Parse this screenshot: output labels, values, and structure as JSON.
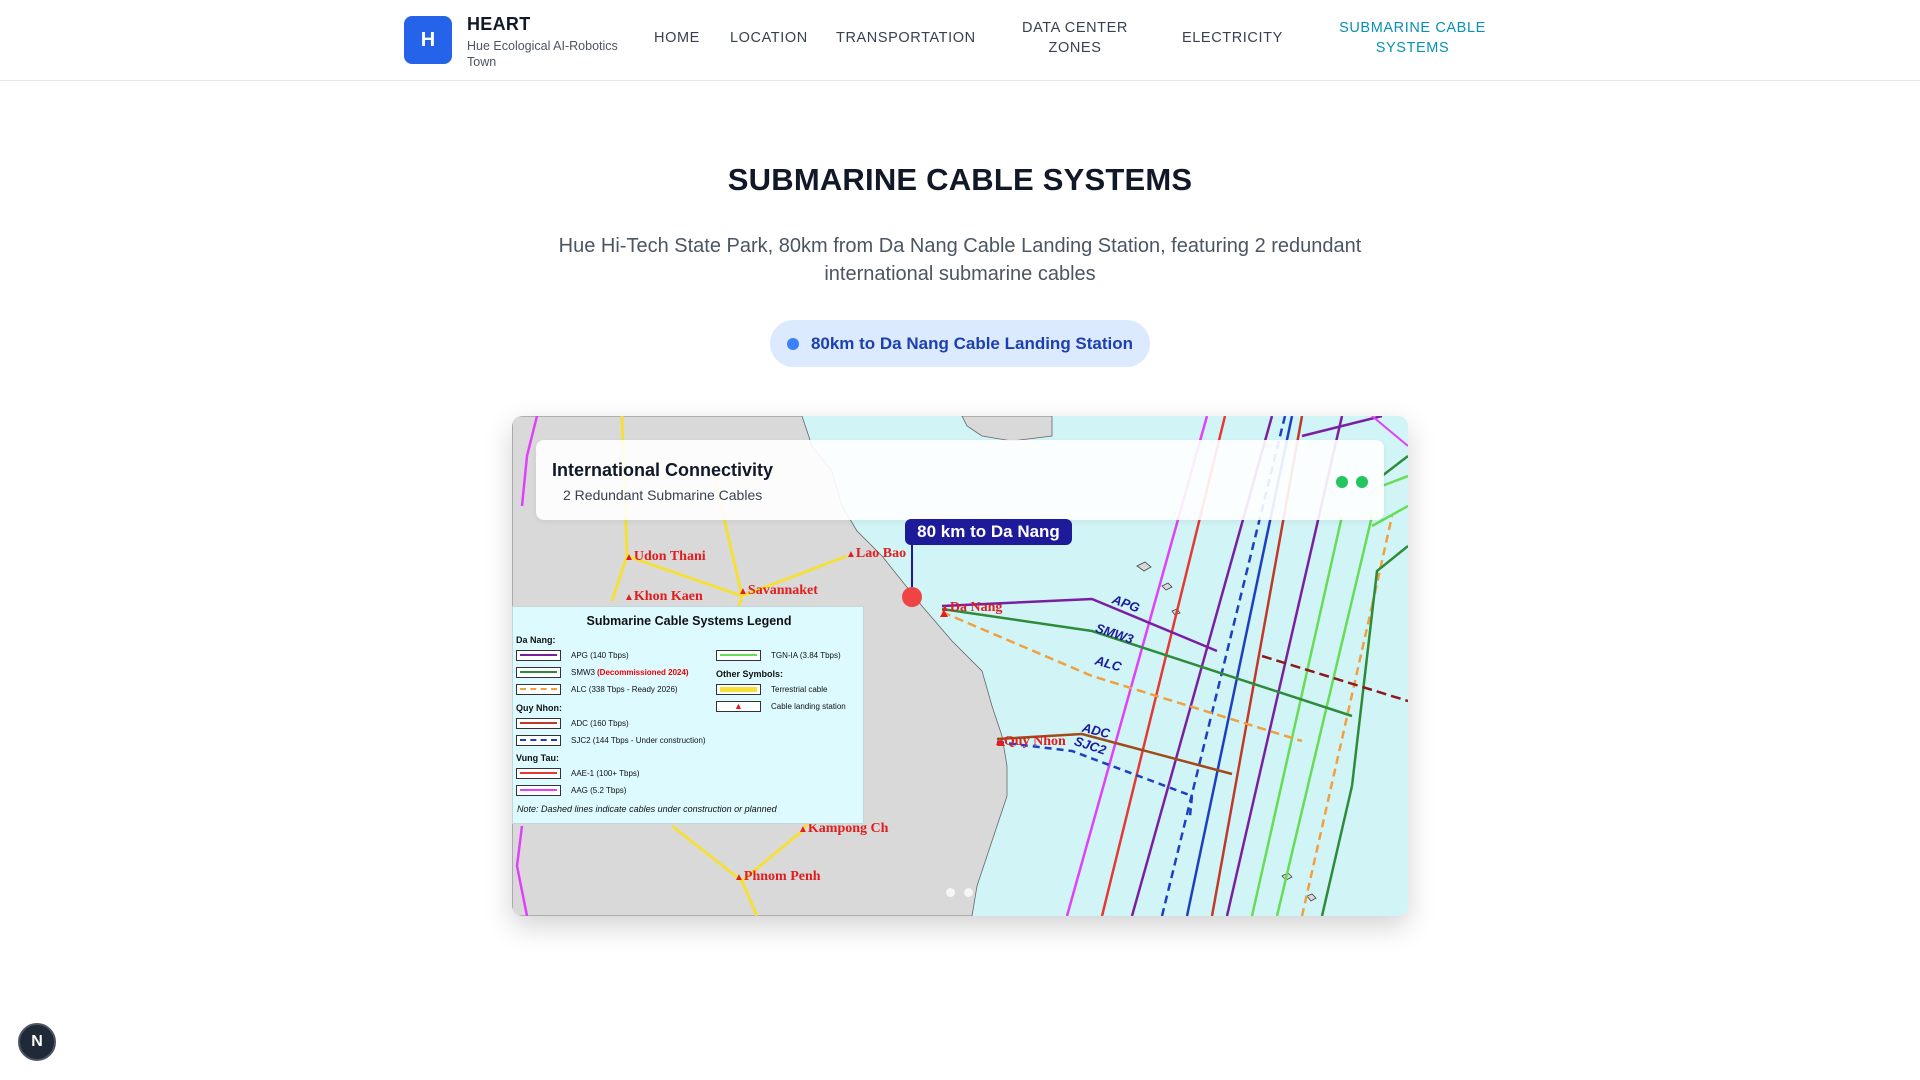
{
  "header": {
    "logo_letter": "H",
    "brand_title": "HEART",
    "brand_subtitle": "Hue Ecological AI-Robotics Town",
    "nav": [
      {
        "label": "HOME"
      },
      {
        "label": "LOCATION"
      },
      {
        "label": "TRANSPORTATION"
      },
      {
        "label": "DATA CENTER ZONES"
      },
      {
        "label": "ELECTRICITY"
      },
      {
        "label": "SUBMARINE CABLE SYSTEMS"
      }
    ],
    "active_nav": "SUBMARINE CABLE SYSTEMS"
  },
  "hero": {
    "title": "SUBMARINE CABLE SYSTEMS",
    "subtitle": "Hue Hi-Tech State Park, 80km from Da Nang Cable Landing Station, featuring 2 redundant international submarine cables",
    "pill_text": "80km to Da Nang Cable Landing Station"
  },
  "map": {
    "panel_title": "International Connectivity",
    "panel_subtitle": "2 Redundant Submarine Cables",
    "callout": "80 km to Da Nang",
    "cities": [
      "Udon Thani",
      "Lao Bao",
      "Khon Kaen",
      "Savannaket",
      "Da Nang",
      "Quy Nhon",
      "Kampong Ch",
      "Phnom Penh"
    ],
    "cable_labels": [
      "APG",
      "SMW3",
      "ALC",
      "ADC",
      "SJC2"
    ],
    "legend": {
      "title": "Submarine Cable Systems Legend",
      "groups": {
        "da_nang": "Da Nang:",
        "quy_nhon": "Quy Nhon:",
        "vung_tau": "Vung Tau:",
        "other": "Other Symbols:"
      },
      "items": {
        "apg": "APG (140 Tbps)",
        "smw3": "SMW3",
        "smw3_note": "(Decommissioned 2024)",
        "alc": "ALC (338 Tbps - Ready 2026)",
        "adc": "ADC (160 Tbps)",
        "sjc2": "SJC2 (144 Tbps - Under construction)",
        "aae1": "AAE-1 (100+ Tbps)",
        "aag": "AAG (5.2 Tbps)",
        "tgn": "TGN-IA (3.84 Tbps)",
        "terrestrial": "Terrestrial cable",
        "landing": "Cable landing station"
      },
      "note": "Note: Dashed lines indicate cables under construction or planned"
    },
    "colors": {
      "apg": "#7b1fa2",
      "smw3": "#2e8b3a",
      "alc": "#f0a040",
      "adc": "#c0392b",
      "sjc2": "#1f3fbf",
      "aae1": "#e53935",
      "aag": "#e040fb",
      "tgn": "#66dd55",
      "terrestrial": "#f5e03a",
      "land": "#d9d9d9",
      "sea": "#d1f5f7"
    }
  },
  "footer": {
    "badge_letter": "N"
  }
}
